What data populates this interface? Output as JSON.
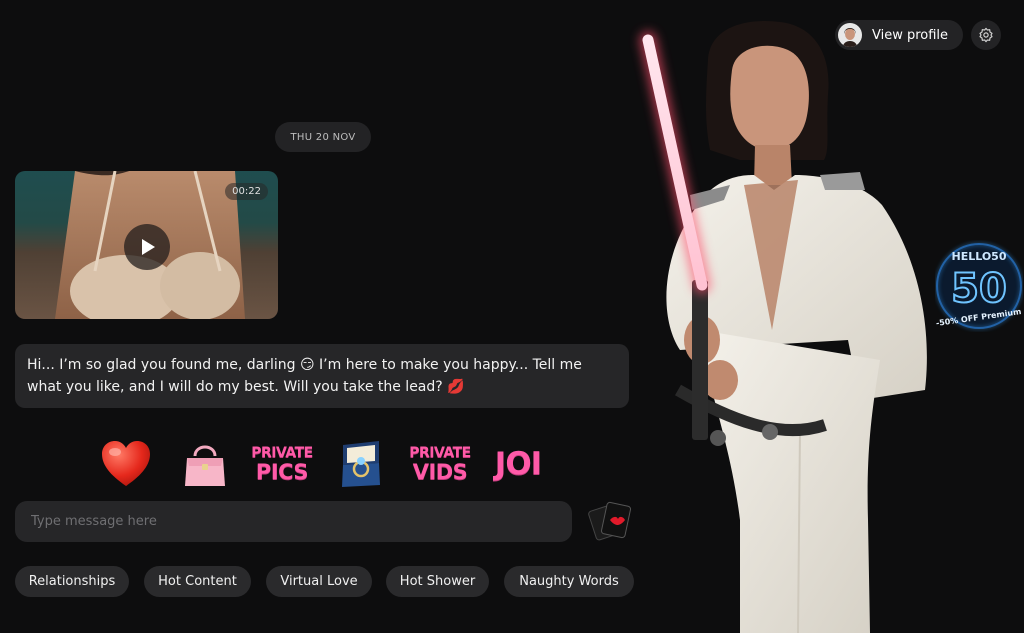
{
  "header": {
    "view_profile_label": "View profile"
  },
  "chat": {
    "date_label": "THU 20 NOV",
    "video": {
      "duration": "00:22"
    },
    "message": "Hi... I’m so glad you found me, darling 😏 I’m here to make you happy... Tell me what you like, and I will do my best. Will you take the lead? 💋"
  },
  "gifts": {
    "heart": "heart-gift",
    "bag": "handbag-gift",
    "private_pics_line1": "PRIVATE",
    "private_pics_line2": "PICS",
    "ring": "ring-box-gift",
    "private_vids_line1": "PRIVATE",
    "private_vids_line2": "VIDS",
    "joi": "JOI"
  },
  "input": {
    "placeholder": "Type message here"
  },
  "chips": [
    "Relationships",
    "Hot Content",
    "Virtual Love",
    "Hot Shower",
    "Naughty Words"
  ],
  "promo": {
    "code": "HELLO50",
    "number": "50",
    "caption": "-50% OFF Premium"
  },
  "colors": {
    "background": "#0d0d0e",
    "surface": "#262628",
    "chip": "#2a2a2c",
    "accent_pink": "#ff5aa8",
    "neon_blue": "#3aa6ff"
  }
}
